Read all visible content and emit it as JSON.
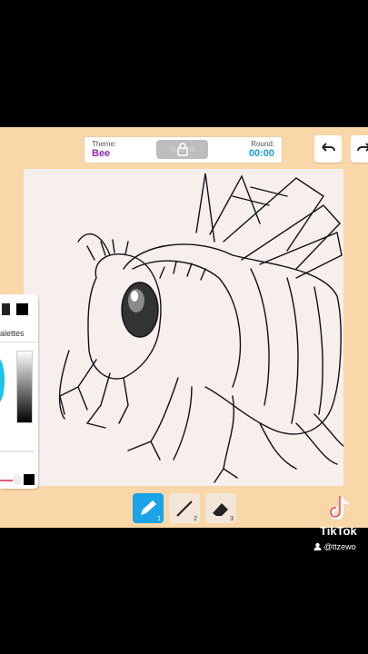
{
  "header": {
    "theme_label": "Theme:",
    "theme_value": "Bee",
    "submit_label": "Submit",
    "round_label": "Round:",
    "round_timer": "00:00"
  },
  "palette": {
    "title": "alettes",
    "colors": [
      "#222222",
      "#000000"
    ]
  },
  "tools": [
    {
      "name": "pencil",
      "number": "1",
      "selected": true
    },
    {
      "name": "line",
      "number": "2",
      "selected": false
    },
    {
      "name": "eraser",
      "number": "3",
      "selected": false
    }
  ],
  "watermark": {
    "brand": "TikTok",
    "handle": "@ttzewo"
  },
  "colors": {
    "background": "#f9d7a8",
    "theme_text": "#8b2bb0",
    "round_text": "#1a9fcf",
    "tool_selected": "#1aa3e6",
    "canvas": "#f7eeee"
  }
}
